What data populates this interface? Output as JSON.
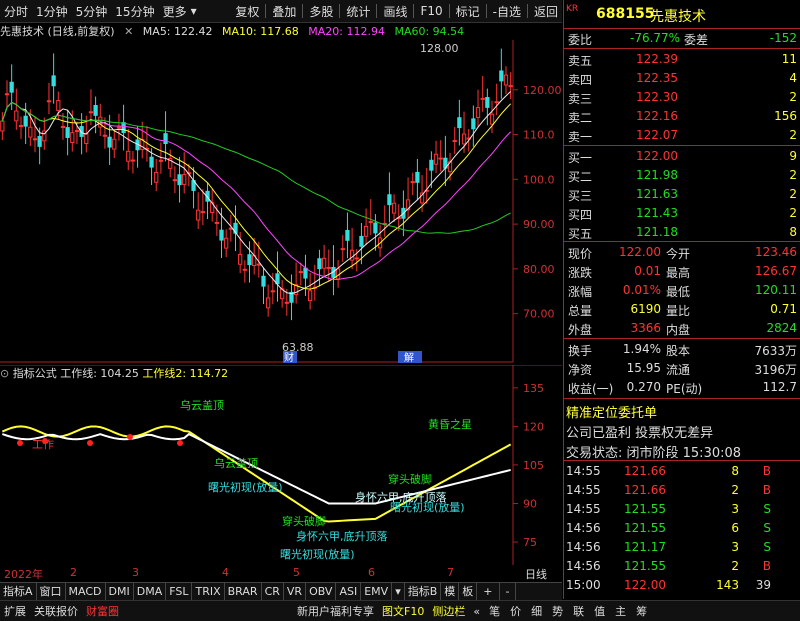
{
  "toolbar": {
    "left": [
      "分时",
      "1分钟",
      "5分钟",
      "15分钟",
      "更多"
    ],
    "right": [
      "复权",
      "叠加",
      "多股",
      "统计",
      "画线",
      "F10",
      "标记",
      "-自选",
      "返回"
    ]
  },
  "title_line": {
    "stock": "先惠技术 (日线,前复权)",
    "ma5": "MA5: 122.42",
    "ma10": "MA10: 117.68",
    "ma20": "MA20: 112.94",
    "ma60": "MA60: 94.54"
  },
  "main_chart": {
    "price_labels": [
      "120.00",
      "110.0",
      "100.0",
      "90.00",
      "80.00",
      "70.00"
    ],
    "price_values": [
      120,
      110,
      100,
      90,
      80,
      70
    ],
    "high_annotation": "128.00",
    "low_annotation": "63.88",
    "badge_cai": "财",
    "badge_jie": "解"
  },
  "indicator": {
    "name": "指标公式",
    "line1": "工作线: 104.25",
    "line2": "工作线2: 114.72",
    "axis_labels": [
      "135.0",
      "120.0",
      "105.0",
      "90.00",
      "75.00"
    ],
    "axis_values": [
      135,
      120,
      105,
      90,
      75
    ],
    "annotations": {
      "wuyun1": "乌云盖顶",
      "wuyun2": "乌云盖顶",
      "shuguang1": "曙光初现(放量)",
      "shuguang2": "曙光初现(放量)",
      "shuguang3": "曙光初现(放量)",
      "huanghun": "黄昏之星",
      "chuantou1": "穿头破脚",
      "chuantou2": "穿头破脚",
      "shenhuai": "身怀六甲,底升顶落",
      "shenhuai2": "身怀六甲,底升顶落",
      "gongzuo": "工作"
    }
  },
  "date_axis": {
    "year": "2022年",
    "months": [
      "2",
      "3",
      "4",
      "5",
      "6",
      "7"
    ],
    "period": "日线"
  },
  "bottom_tabs": [
    "指标A",
    "窗口",
    "MACD",
    "DMI",
    "DMA",
    "FSL",
    "TRIX",
    "BRAR",
    "CR",
    "VR",
    "OBV",
    "ASI",
    "EMV",
    "指标B",
    "模",
    "板",
    "+",
    "-"
  ],
  "bottom_bar": {
    "left": [
      "扩展",
      "关联报价",
      "财富圈"
    ],
    "mid": [
      "新用户福利专享",
      "图文F10",
      "侧边栏"
    ],
    "right": [
      "笔",
      "价",
      "细",
      "势",
      "联",
      "值",
      "主",
      "筹"
    ]
  },
  "quote": {
    "market": "KR",
    "code": "688155",
    "name": "先惠技术",
    "weibi_label": "委比",
    "weibi": "-76.77%",
    "weicha_label": "委差",
    "weicha": "-152",
    "asks": [
      {
        "label": "卖五",
        "price": "122.39",
        "vol": "11"
      },
      {
        "label": "卖四",
        "price": "122.35",
        "vol": "4"
      },
      {
        "label": "卖三",
        "price": "122.30",
        "vol": "2"
      },
      {
        "label": "卖二",
        "price": "122.16",
        "vol": "156"
      },
      {
        "label": "卖一",
        "price": "122.07",
        "vol": "2"
      }
    ],
    "bids": [
      {
        "label": "买一",
        "price": "122.00",
        "vol": "9"
      },
      {
        "label": "买二",
        "price": "121.98",
        "vol": "2"
      },
      {
        "label": "买三",
        "price": "121.63",
        "vol": "2"
      },
      {
        "label": "买四",
        "price": "121.43",
        "vol": "2"
      },
      {
        "label": "买五",
        "price": "121.18",
        "vol": "8"
      }
    ],
    "stats": [
      {
        "l1": "现价",
        "v1": "122.00",
        "c1": "red",
        "l2": "今开",
        "v2": "123.46",
        "c2": "red"
      },
      {
        "l1": "涨跌",
        "v1": "0.01",
        "c1": "red",
        "l2": "最高",
        "v2": "126.67",
        "c2": "red"
      },
      {
        "l1": "涨幅",
        "v1": "0.01%",
        "c1": "red",
        "l2": "最低",
        "v2": "120.11",
        "c2": "green"
      },
      {
        "l1": "总量",
        "v1": "6190",
        "c1": "yel",
        "l2": "量比",
        "v2": "0.71",
        "c2": "yel"
      },
      {
        "l1": "外盘",
        "v1": "3366",
        "c1": "red",
        "l2": "内盘",
        "v2": "2824",
        "c2": "green"
      }
    ],
    "stats2": [
      {
        "l1": "换手",
        "v1": "1.94%",
        "l2": "股本",
        "v2": "7633万"
      },
      {
        "l1": "净资",
        "v1": "15.95",
        "l2": "流通",
        "v2": "3196万"
      },
      {
        "l1": "收益(一)",
        "v1": "0.270",
        "l2": "PE(动)",
        "v2": "112.7"
      }
    ],
    "order_title": "精准定位委托单",
    "profit_note": "公司已盈利 投票权无差异",
    "trade_status": "交易状态: 闭市阶段 15:30:08",
    "ticks": [
      {
        "t": "14:55",
        "p": "121.66",
        "v": "8",
        "s": "B"
      },
      {
        "t": "14:55",
        "p": "121.66",
        "v": "2",
        "s": "B"
      },
      {
        "t": "14:55",
        "p": "121.55",
        "v": "3",
        "s": "S"
      },
      {
        "t": "14:56",
        "p": "121.55",
        "v": "6",
        "s": "S"
      },
      {
        "t": "14:56",
        "p": "121.17",
        "v": "3",
        "s": "S"
      },
      {
        "t": "14:56",
        "p": "121.55",
        "v": "2",
        "s": "B"
      },
      {
        "t": "15:00",
        "p": "122.00",
        "v": "143",
        "s": "39"
      }
    ]
  }
}
